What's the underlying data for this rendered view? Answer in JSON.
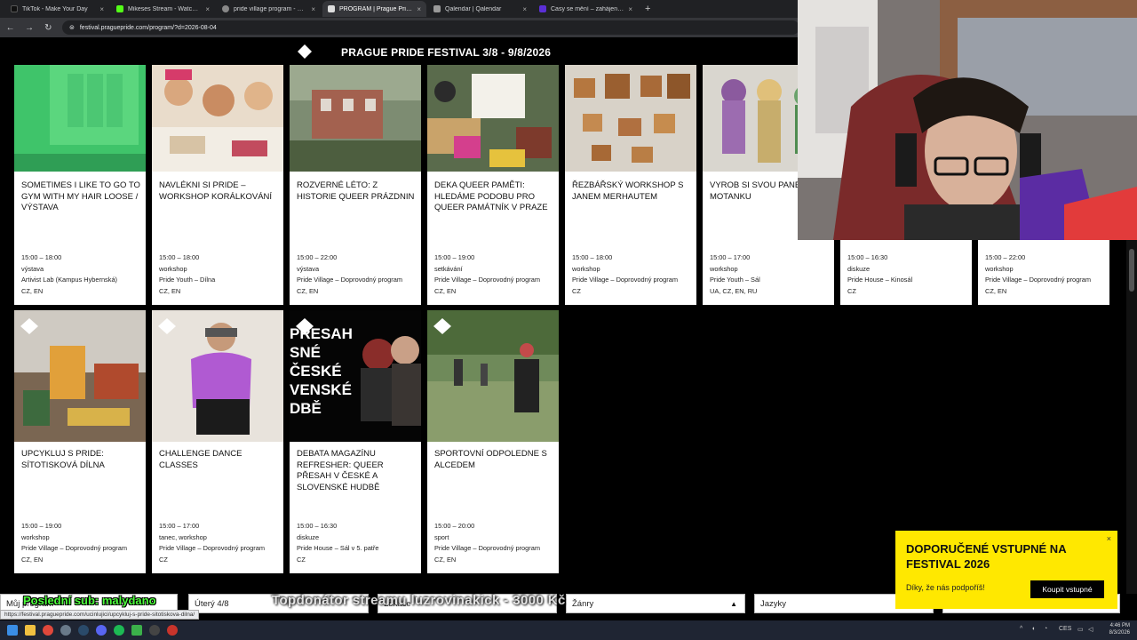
{
  "browser": {
    "tabs": [
      {
        "label": "TikTok - Make Your Day",
        "color": "#111111"
      },
      {
        "label": "Mikeses Stream - Watch Live o",
        "color": "#53fc18"
      },
      {
        "label": "pride village program - Hledat",
        "color": "#888888"
      },
      {
        "label": "PROGRAM | Prague Pride Festi",
        "color": "#dddddd"
      },
      {
        "label": "Qalendar | Qalendar",
        "color": "#999999"
      },
      {
        "label": "Časy se mění – zahájení festival",
        "color": "#5b2fd6"
      }
    ],
    "new_tab": "+",
    "close_glyph": "×",
    "url": "festival.praguepride.com/program/?d=2026-08-04"
  },
  "header": {
    "title": "PRAGUE PRIDE FESTIVAL 3/8 - 9/8/2026"
  },
  "events": [
    {
      "title": "SOMETIMES I LIKE TO GO TO GYM WITH MY HAIR LOOSE / VÝSTAVA",
      "time": "15:00 – 18:00",
      "type": "výstava",
      "place": "Artivist Lab (Kampus Hybernská)",
      "lang": "CZ, EN"
    },
    {
      "title": "NAVLÉKNI SI PRIDE – WORKSHOP KORÁLKOVÁNÍ",
      "time": "15:00 – 18:00",
      "type": "workshop",
      "place": "Pride Youth – Dílna",
      "lang": "CZ, EN"
    },
    {
      "title": "ROZVERNÉ LÉTO: Z HISTORIE QUEER PRÁZDNIN",
      "time": "15:00 – 22:00",
      "type": "výstava",
      "place": "Pride Village – Doprovodný program",
      "lang": "CZ, EN"
    },
    {
      "title": "DEKA QUEER PAMĚTI: HLEDÁME PODOBU PRO QUEER PAMÁTNÍK V PRAZE",
      "time": "15:00 – 19:00",
      "type": "setkávání",
      "place": "Pride Village – Doprovodný program",
      "lang": "CZ, EN"
    },
    {
      "title": "ŘEZBÁŘSKÝ WORKSHOP S JANEM MERHAUTEM",
      "time": "15:00 – 18:00",
      "type": "workshop",
      "place": "Pride Village – Doprovodný program",
      "lang": "CZ"
    },
    {
      "title": "VYROB SI SVOU PANENKU MOTANKU",
      "time": "15:00 – 17:00",
      "type": "workshop",
      "place": "Pride Youth – Sál",
      "lang": "UA, CZ, EN, RU"
    },
    {
      "title": "",
      "time": "15:00 – 16:30",
      "type": "diskuze",
      "place": "Pride House – Kinosál",
      "lang": "CZ"
    },
    {
      "title": "",
      "time": "15:00 – 22:00",
      "type": "workshop",
      "place": "Pride Village – Doprovodný program",
      "lang": "CZ, EN"
    },
    {
      "title": "UPCYKLUJ S PRIDE: SÍTOTISKOVÁ DÍLNA",
      "time": "15:00 – 19:00",
      "type": "workshop",
      "place": "Pride Village – Doprovodný program",
      "lang": "CZ, EN"
    },
    {
      "title": "CHALLENGE DANCE CLASSES",
      "time": "15:00 – 17:00",
      "type": "tanec, workshop",
      "place": "Pride Village – Doprovodný program",
      "lang": "CZ"
    },
    {
      "title": "DEBATA MAGAZÍNU REFRESHER: QUEER PŘESAH V ČESKÉ A SLOVENSKÉ HUDBĚ",
      "time": "15:00 – 16:30",
      "type": "diskuze",
      "place": "Pride House – Sál v 5. patře",
      "lang": "CZ",
      "poster_text": "PŘESAH SNÉ ČESKÉ VENSKÉ DBĚ"
    },
    {
      "title": "SPORTOVNÍ ODPOLEDNE S ALCEDEM",
      "time": "15:00 – 20:00",
      "type": "sport",
      "place": "Pride Village – Doprovodný program",
      "lang": "CZ, EN"
    }
  ],
  "filters": {
    "program": "Můj program",
    "day": "Úterý 4/8",
    "location": "Lokace",
    "genre": "Žánry",
    "languages": "Jazyky"
  },
  "overlays": {
    "last_sub": "Poslední sub: malydano",
    "top_donor": "Topdonátor streamu luzrovinakick - 3000 Kč",
    "status_url": "https://festival.praguepride.com/ucinlujici/upcykluj-s-pride-sitotiskova-dilna/"
  },
  "promo": {
    "title": "DOPORUČENÉ VSTUPNÉ NA FESTIVAL 2026",
    "subtitle": "Díky, že nás podpoříš!",
    "button": "Koupit vstupné",
    "close": "×"
  },
  "taskbar": {
    "lang": "CES",
    "time": "4:46 PM",
    "date": "8/3/2026"
  },
  "colors": {
    "accent_yellow": "#ffe800",
    "card_bg": "#ffffff",
    "page_bg": "#000000"
  }
}
